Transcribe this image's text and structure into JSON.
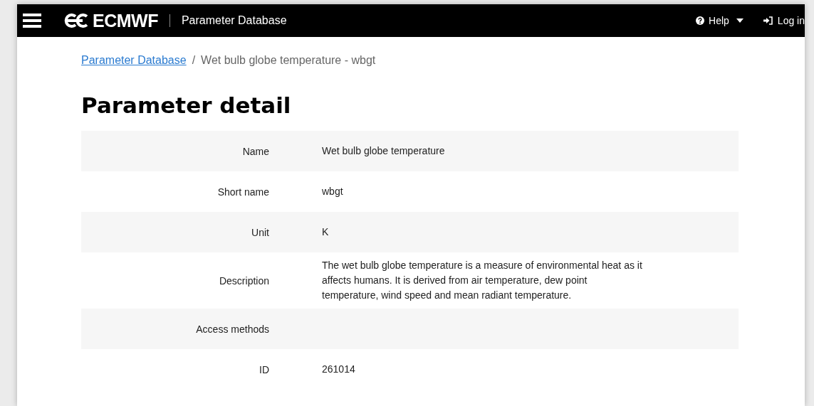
{
  "header": {
    "logo_text": "ECMWF",
    "app_title": "Parameter Database",
    "help": "Help",
    "login": "Log in"
  },
  "breadcrumb": {
    "link": "Parameter Database",
    "separator": "/",
    "current": "Wet bulb globe temperature - wbgt"
  },
  "heading": "Parameter detail",
  "details": [
    {
      "label": "Name",
      "value": "Wet bulb globe temperature"
    },
    {
      "label": "Short name",
      "value": "wbgt"
    },
    {
      "label": "Unit",
      "value": "K"
    },
    {
      "label": "Description",
      "value": "The wet bulb globe temperature is a measure of environmental heat as it affects humans. It is derived from air temperature, dew point temperature, wind speed and mean radiant temperature."
    },
    {
      "label": "Access methods"
    },
    {
      "label": "ID",
      "value": "261014"
    }
  ]
}
